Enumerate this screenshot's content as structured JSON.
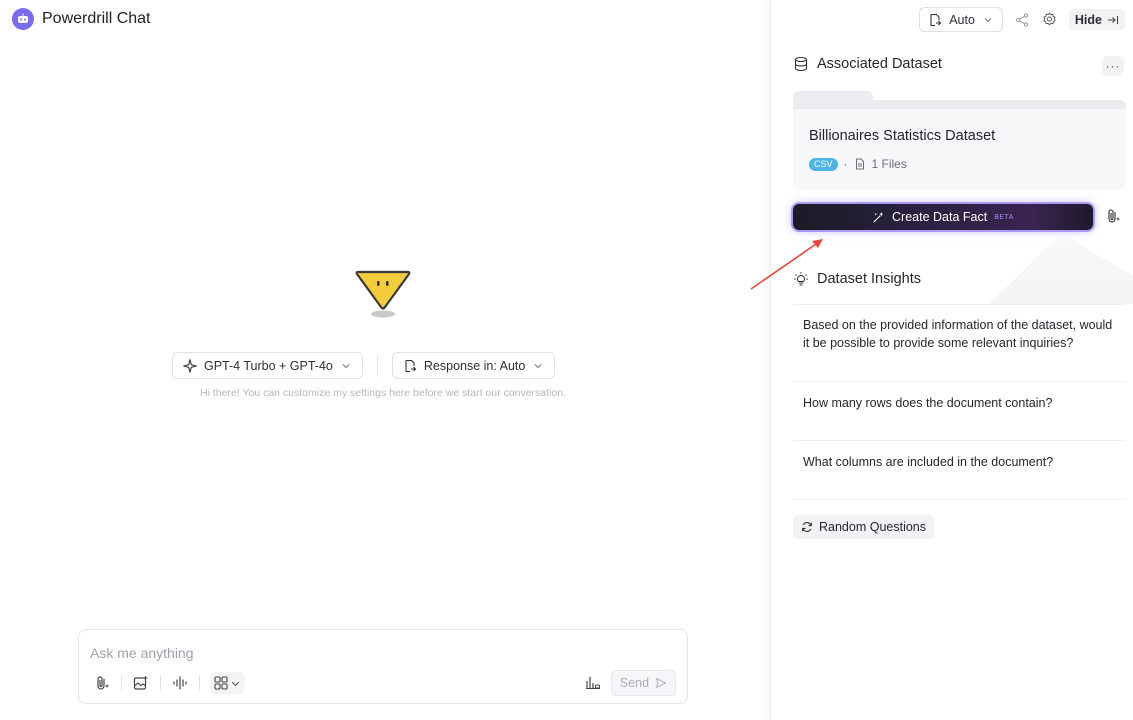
{
  "app": {
    "title": "Powerdrill Chat"
  },
  "center": {
    "model_selector": "GPT-4 Turbo + GPT-4o",
    "response_selector": "Response in: Auto",
    "hint": "Hi there! You can customize my settings here before we start our conversation."
  },
  "composer": {
    "placeholder": "Ask me anything",
    "send_label": "Send"
  },
  "panel": {
    "mode_selector": "Auto",
    "hide_label": "Hide",
    "associated_title": "Associated Dataset",
    "more_label": "···",
    "dataset": {
      "name": "Billionaires Statistics Dataset",
      "badge": "CSV",
      "separator": "·",
      "files": "1 Files"
    },
    "create_button": {
      "label": "Create Data Fact",
      "tag": "BETA"
    },
    "insights_title": "Dataset Insights",
    "questions": [
      "Based on the provided information of the dataset, would it be possible to provide some relevant inquiries?",
      "How many rows does the document contain?",
      "What columns are included in the document?"
    ],
    "random_label": "Random Questions"
  },
  "colors": {
    "brand": "#7a6cf0",
    "accent_glow": "#7c5ef0",
    "csv_badge": "#4fb3e8",
    "annotation_arrow": "#e8483a",
    "mascot": "#f5cc3c"
  }
}
